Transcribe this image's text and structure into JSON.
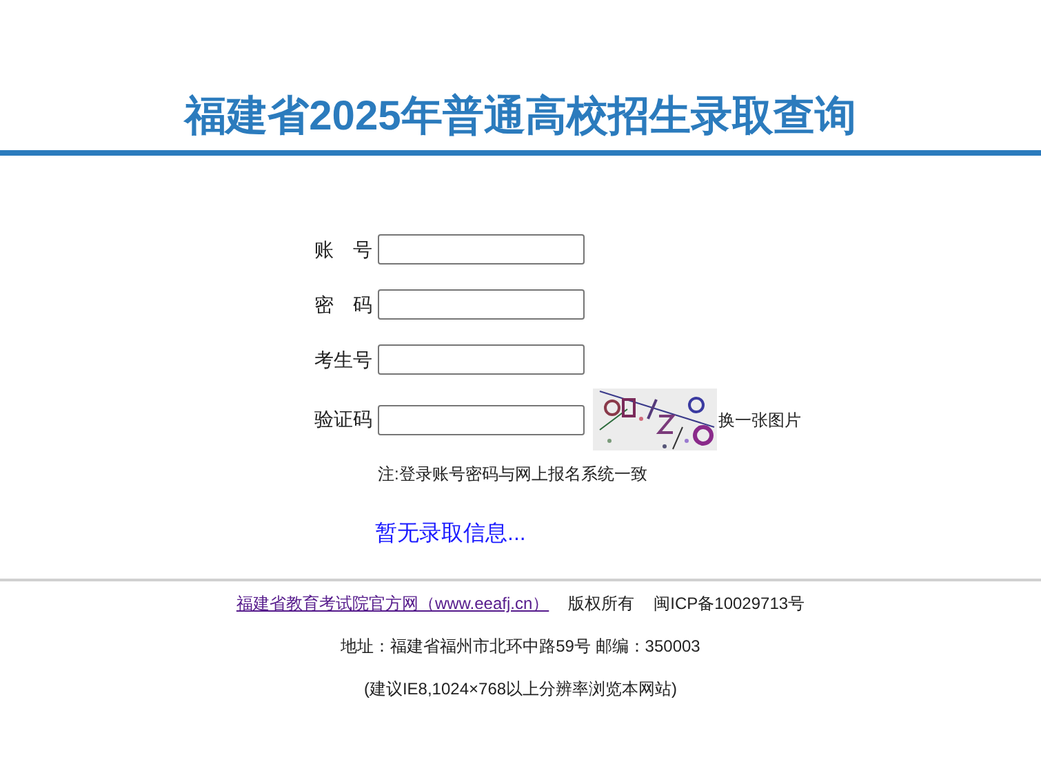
{
  "title": "福建省2025年普通高校招生录取查询",
  "fields": [
    {
      "label": "账　号"
    },
    {
      "label": "密　码"
    },
    {
      "label": "考生号"
    },
    {
      "label": "验证码"
    }
  ],
  "captcha": {
    "refresh_link": "换一张图片"
  },
  "note": "注:登录账号密码与网上报名系统一致",
  "message": "暂无录取信息...",
  "footer": {
    "link": "福建省教育考试院官方网（www.eeafj.cn）",
    "copyright": "版权所有",
    "icp": "闽ICP备10029713号",
    "address": "地址：福建省福州市北环中路59号 邮编：350003",
    "advice": "(建议IE8,1024×768以上分辨率浏览本网站)"
  }
}
